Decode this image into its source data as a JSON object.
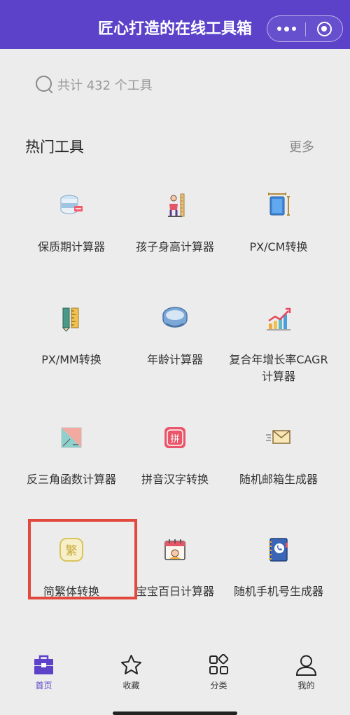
{
  "header": {
    "title": "匠心打造的在线工具箱"
  },
  "search": {
    "placeholder": "共计 432 个工具"
  },
  "section": {
    "title": "热门工具",
    "more": "更多"
  },
  "tools": [
    {
      "label": "保质期计算器",
      "icon": "food-can-icon"
    },
    {
      "label": "孩子身高计算器",
      "icon": "child-height-icon"
    },
    {
      "label": "PX/CM转换",
      "icon": "ruler-tablet-icon"
    },
    {
      "label": "PX/MM转换",
      "icon": "ruler-pencil-icon"
    },
    {
      "label": "年龄计算器",
      "icon": "age-ring-icon"
    },
    {
      "label": "复合年增长率CAGR计算器",
      "icon": "growth-chart-icon"
    },
    {
      "label": "反三角函数计算器",
      "icon": "triangle-function-icon"
    },
    {
      "label": "拼音汉字转换",
      "icon": "pinyin-icon"
    },
    {
      "label": "随机邮箱生成器",
      "icon": "envelope-icon"
    },
    {
      "label": "简繁体转换",
      "icon": "traditional-char-icon",
      "icon_char": "繁"
    },
    {
      "label": "宝宝百日计算器",
      "icon": "calendar-baby-icon"
    },
    {
      "label": "随机手机号生成器",
      "icon": "phone-book-icon"
    }
  ],
  "tabbar": [
    {
      "label": "首页",
      "icon": "toolbox-icon",
      "active": true
    },
    {
      "label": "收藏",
      "icon": "star-icon"
    },
    {
      "label": "分类",
      "icon": "category-grid-icon"
    },
    {
      "label": "我的",
      "icon": "user-icon"
    }
  ],
  "colors": {
    "brand": "#5b42c9",
    "highlight": "#e2483c",
    "background": "#ececec"
  }
}
